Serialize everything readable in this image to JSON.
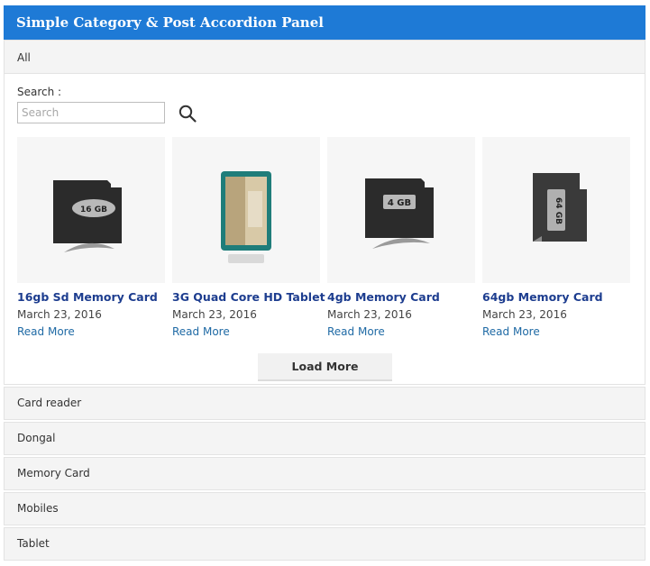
{
  "panel": {
    "title": "Simple Category & Post Accordion Panel"
  },
  "active_category": {
    "label": "All"
  },
  "search": {
    "label": "Search :",
    "placeholder": "Search",
    "value": ""
  },
  "posts": [
    {
      "title": "16gb Sd Memory Card",
      "date": "March 23, 2016",
      "read_more": "Read More",
      "image_text": "16 GB"
    },
    {
      "title": "3G Quad Core HD Tablet",
      "date": "March 23, 2016",
      "read_more": "Read More",
      "image_text": ""
    },
    {
      "title": "4gb Memory Card",
      "date": "March 23, 2016",
      "read_more": "Read More",
      "image_text": "4 GB"
    },
    {
      "title": "64gb Memory Card",
      "date": "March 23, 2016",
      "read_more": "Read More",
      "image_text": "64 GB"
    }
  ],
  "load_more_label": "Load More",
  "categories": [
    {
      "label": "Card reader"
    },
    {
      "label": "Dongal"
    },
    {
      "label": "Memory Card"
    },
    {
      "label": "Mobiles"
    },
    {
      "label": "Tablet"
    }
  ],
  "colors": {
    "header": "#1e7ad6",
    "post_title": "#1d3d8f",
    "link": "#1f6aa5"
  }
}
